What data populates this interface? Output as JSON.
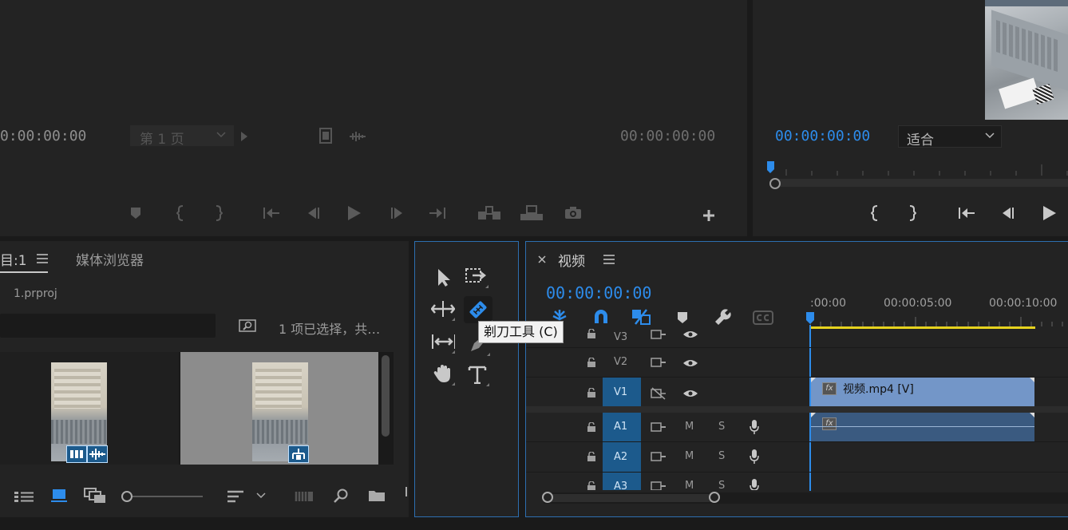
{
  "source_monitor": {
    "timecode_left": "0:00:00:00",
    "page_select": "第 1 页",
    "timecode_right": "00:00:00:00"
  },
  "program_monitor": {
    "timecode": "00:00:00:00",
    "fit_select": "适合"
  },
  "project_panel": {
    "tab_project": "目:1",
    "tab_media_browser": "媒体浏览器",
    "project_file": "1.prproj",
    "selection_status": "1 项已选择，共…"
  },
  "tools": {
    "tooltip": "剃刀工具 (C)"
  },
  "timeline": {
    "tab_title": "视频",
    "timecode": "00:00:00:00",
    "ruler_labels": [
      ":00:00",
      "00:00:05:00",
      "00:00:10:00"
    ],
    "tracks_video": [
      "V3",
      "V2",
      "V1"
    ],
    "tracks_audio": [
      "A1",
      "A2",
      "A3"
    ],
    "mute_label": "M",
    "solo_label": "S",
    "clip_video_name": "视频.mp4 [V]",
    "fx_label": "fx"
  },
  "colors": {
    "accent_blue": "#2d8ceb",
    "clip_video": "#7396c8",
    "clip_audio": "#3a5a80",
    "track_target": "#1c5a8c",
    "panel_bg": "#232323",
    "work_area": "#e6d21e"
  }
}
